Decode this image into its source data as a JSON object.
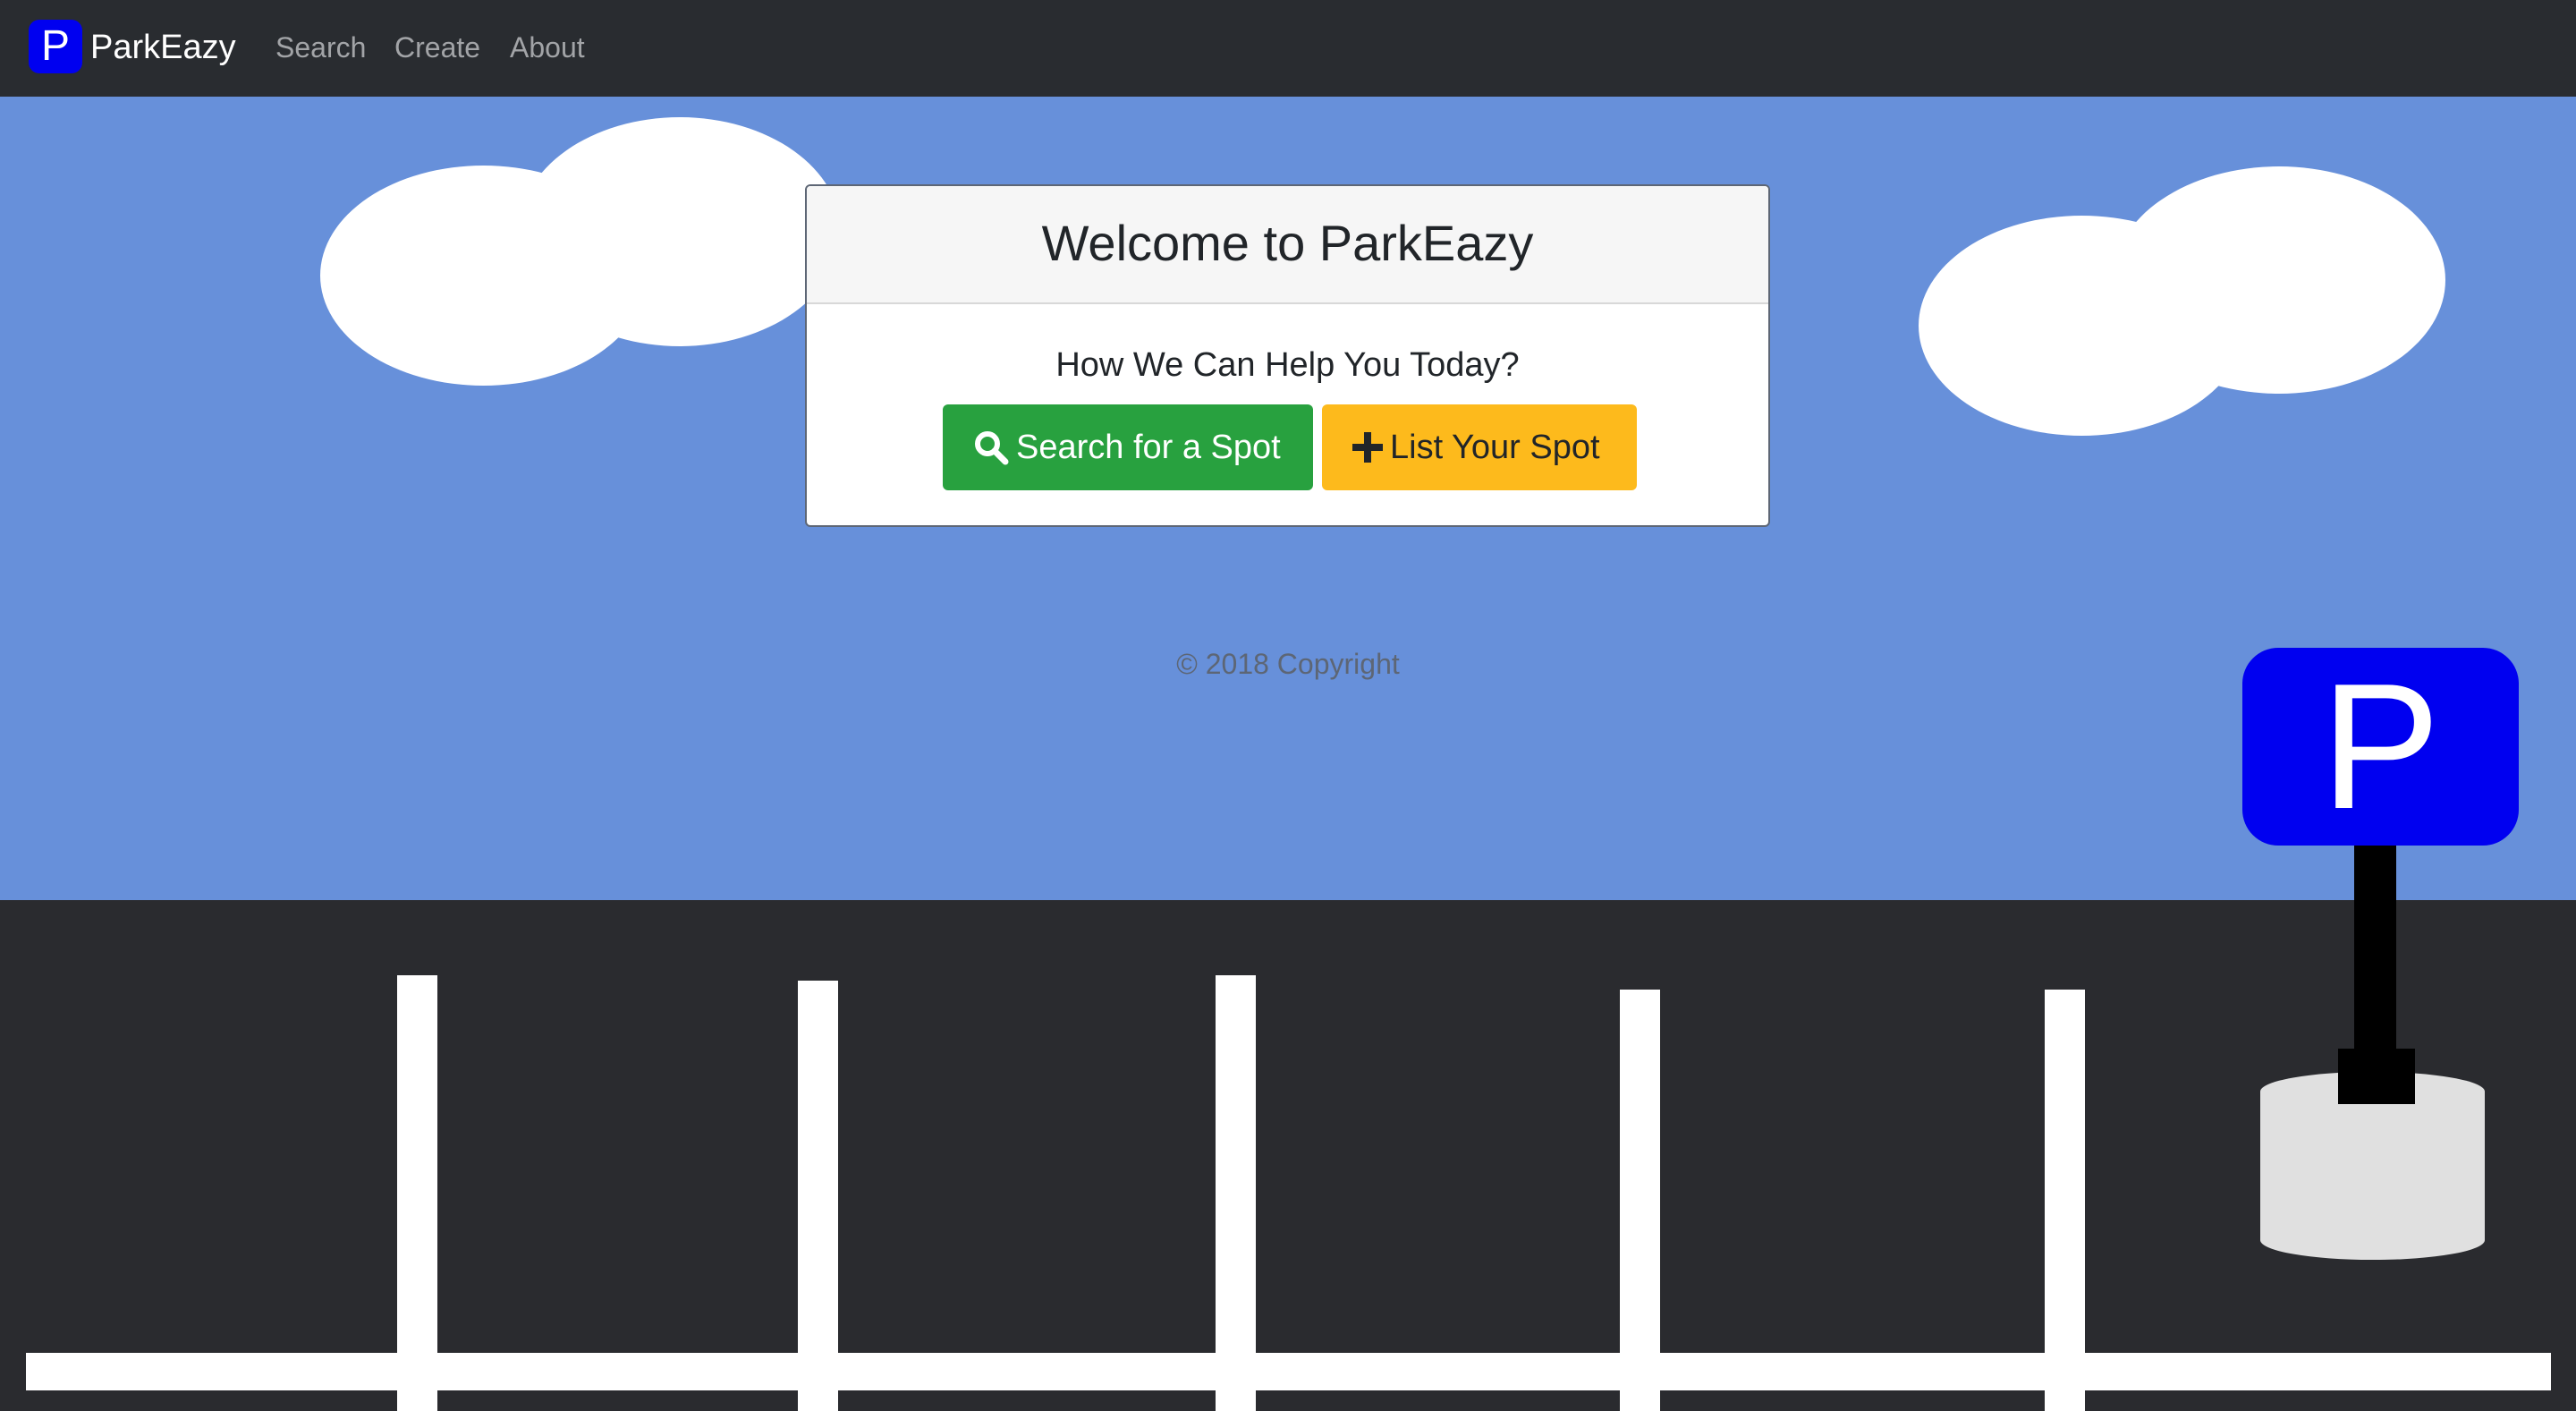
{
  "brand": {
    "logo_letter": "P",
    "name": "ParkEazy",
    "logo_color": "#0000f0"
  },
  "nav": {
    "links": [
      {
        "label": "Search"
      },
      {
        "label": "Create"
      },
      {
        "label": "About"
      }
    ]
  },
  "card": {
    "title": "Welcome to ParkEazy",
    "subtitle": "How We Can Help You Today?",
    "buttons": {
      "search": {
        "label": "Search for a Spot",
        "icon": "search-icon",
        "color": "#28a13f"
      },
      "list": {
        "label": "List Your Spot",
        "icon": "plus-icon",
        "color": "#fdba1c"
      }
    }
  },
  "footer": {
    "copyright": "© 2018 Copyright"
  },
  "scene": {
    "sky_color": "#6790da",
    "ground_color": "#2a2b2f",
    "parking_sign_letter": "P",
    "sign_color": "#0000f0"
  }
}
